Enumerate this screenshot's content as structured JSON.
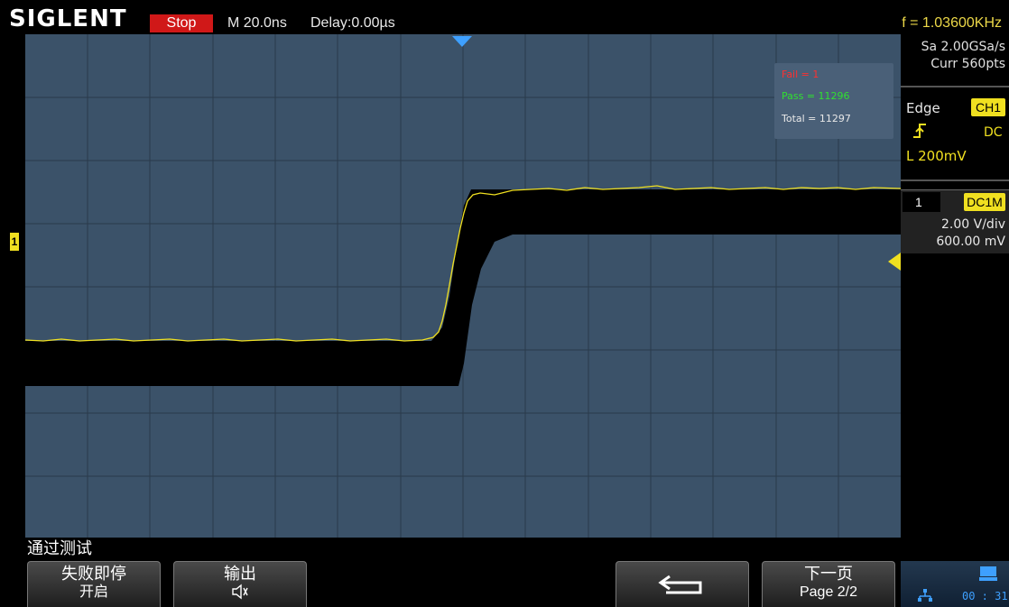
{
  "header": {
    "brand": "SIGLENT",
    "run_status": "Stop",
    "timebase": "M 20.0ns",
    "delay": "Delay:0.00µs",
    "frequency": "f = 1.03600KHz"
  },
  "acquisition": {
    "sample_rate": "Sa 2.00GSa/s",
    "memory": "Curr 560pts"
  },
  "trigger": {
    "type": "Edge",
    "source": "CH1",
    "slope_icon": "rising-edge-icon",
    "coupling": "DC",
    "level": "L  200mV"
  },
  "channel": {
    "number": "1",
    "coupling": "DC1M",
    "scale": "2.00 V/div",
    "offset": "600.00 mV",
    "color": "#f0e020"
  },
  "pass_fail": {
    "fail": "Fail = 1",
    "pass": "Pass = 11296",
    "total": "Total = 11297",
    "fail_color": "#ff3030",
    "pass_color": "#30e030"
  },
  "menu": {
    "title": "通过测试",
    "buttons": [
      {
        "line1": "失败即停",
        "line2": "开启"
      },
      {
        "line1": "输出",
        "line2": "🔈"
      },
      {
        "line1": "",
        "line2": ""
      },
      {
        "line1": "下一页",
        "line2": "Page 2/2"
      }
    ]
  },
  "status": {
    "time": "00 : 31"
  },
  "colors": {
    "grid_bg": "#3b5269",
    "trace": "#f0e020",
    "mask": "#000000",
    "accent_red": "#d01818"
  }
}
